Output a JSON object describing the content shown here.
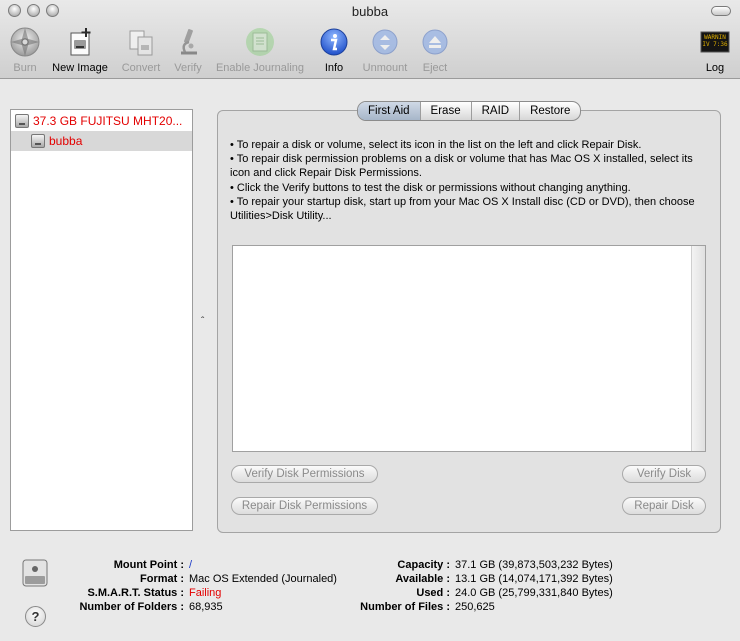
{
  "window": {
    "title": "bubba"
  },
  "toolbar": {
    "burn": "Burn",
    "new_image": "New Image",
    "convert": "Convert",
    "verify": "Verify",
    "enable_journaling": "Enable Journaling",
    "info": "Info",
    "unmount": "Unmount",
    "eject": "Eject",
    "log": "Log",
    "log_icon_text": "WARNIN\nIV 7:36"
  },
  "sidebar": {
    "disk": "37.3 GB FUJITSU MHT20...",
    "volume": "bubba"
  },
  "tabs": [
    "First Aid",
    "Erase",
    "RAID",
    "Restore"
  ],
  "first_aid": {
    "lines": [
      "• To repair a disk or volume, select its icon in the list on the left and click Repair Disk.",
      "• To repair disk permission problems on a disk or volume that has Mac OS X installed, select its icon and click Repair Disk Permissions.",
      "• Click the Verify buttons to test the disk or permissions without changing anything.",
      "• To repair your startup disk, start up from your Mac OS X Install disc (CD or DVD), then choose Utilities>Disk Utility..."
    ],
    "verify_permissions": "Verify Disk Permissions",
    "verify_disk": "Verify Disk",
    "repair_permissions": "Repair Disk Permissions",
    "repair_disk": "Repair Disk"
  },
  "info": {
    "mount_point_label": "Mount Point :",
    "mount_point": "/",
    "format_label": "Format :",
    "format": "Mac OS Extended (Journaled)",
    "smart_label": "S.M.A.R.T. Status :",
    "smart": "Failing",
    "folders_label": "Number of Folders :",
    "folders": "68,935",
    "capacity_label": "Capacity :",
    "capacity": "37.1 GB (39,873,503,232 Bytes)",
    "available_label": "Available :",
    "available": "13.1 GB (14,074,171,392 Bytes)",
    "used_label": "Used :",
    "used": "24.0 GB (25,799,331,840 Bytes)",
    "files_label": "Number of Files :",
    "files": "250,625"
  },
  "colors": {
    "failing": "#e30000",
    "disk_text": "#e30000",
    "mount_link": "#1a39c8",
    "info_icon_blue": "#2f66d8"
  },
  "help_glyph": "?",
  "splitter_glyph": "ˆ"
}
